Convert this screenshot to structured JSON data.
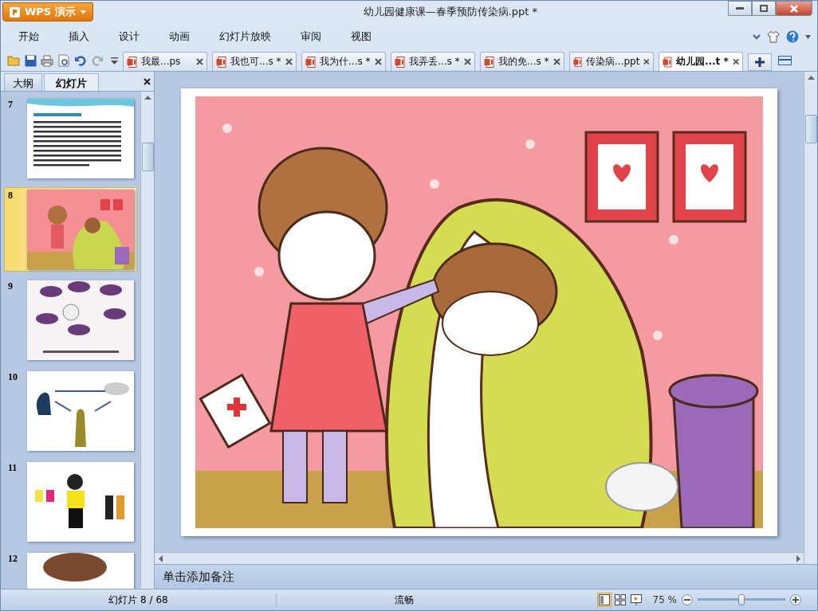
{
  "window": {
    "title": "幼儿园健康课—春季预防传染病.ppt *",
    "app_button": "WPS 演示"
  },
  "menu": [
    {
      "label": "开始"
    },
    {
      "label": "插入"
    },
    {
      "label": "设计"
    },
    {
      "label": "动画"
    },
    {
      "label": "幻灯片放映"
    },
    {
      "label": "审阅"
    },
    {
      "label": "视图"
    }
  ],
  "doc_tabs": [
    {
      "label": "我最...ps",
      "selected": false
    },
    {
      "label": "我也可...s *",
      "selected": false
    },
    {
      "label": "我为什...s *",
      "selected": false
    },
    {
      "label": "我弄丢...s *",
      "selected": false
    },
    {
      "label": "我的免...s *",
      "selected": false
    },
    {
      "label": "传染病...ppt",
      "selected": false
    },
    {
      "label": "幼儿园...t *",
      "selected": true
    }
  ],
  "side_panel": {
    "tabs": [
      {
        "label": "大纲",
        "selected": false
      },
      {
        "label": "幻灯片",
        "selected": true
      }
    ],
    "slides": [
      {
        "number": "7",
        "kind": "text",
        "selected": false
      },
      {
        "number": "8",
        "kind": "kids",
        "selected": true
      },
      {
        "number": "9",
        "kind": "cartoon",
        "selected": false
      },
      {
        "number": "10",
        "kind": "diagram",
        "selected": false
      },
      {
        "number": "11",
        "kind": "people",
        "selected": false
      },
      {
        "number": "12",
        "kind": "photo",
        "selected": false
      }
    ]
  },
  "notes": {
    "placeholder": "单击添加备注"
  },
  "status_bar": {
    "slide_counter": "幻灯片 8 / 68",
    "theme": "流畅",
    "views": [
      {
        "kind": "normal",
        "selected": true
      },
      {
        "kind": "sorter",
        "selected": false
      },
      {
        "kind": "show",
        "selected": false
      }
    ],
    "zoom": "75 %",
    "zoom_slider": {
      "level": 0.5
    }
  }
}
